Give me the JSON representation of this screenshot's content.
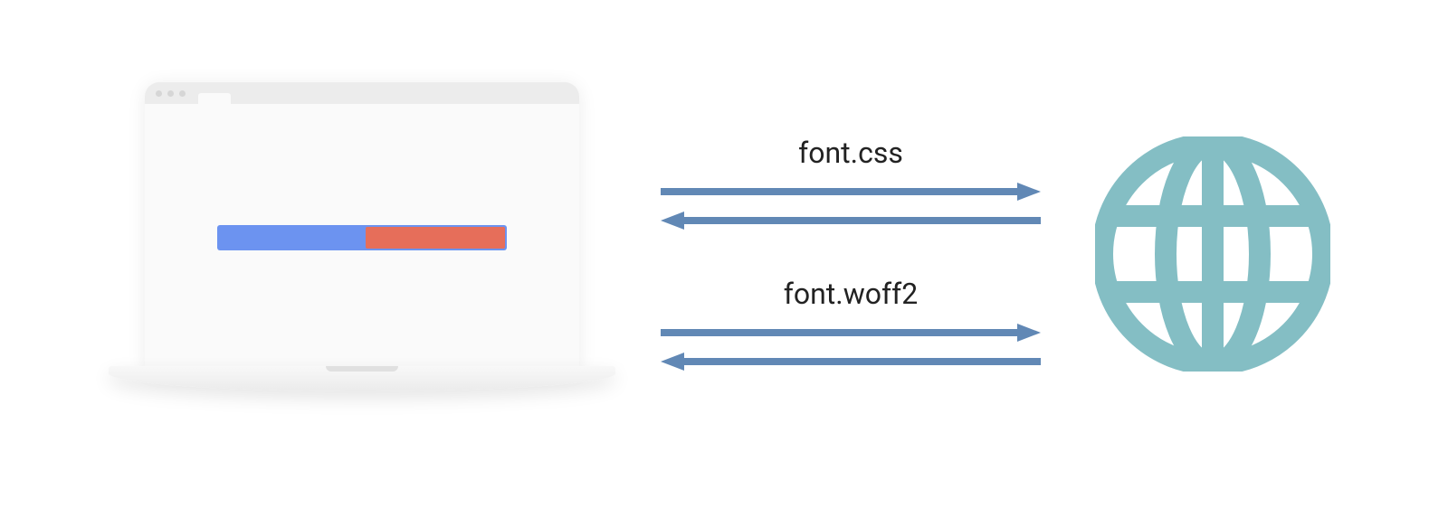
{
  "diagram": {
    "laptop": {
      "progress": {
        "blue_color": "#6c93f0",
        "red_color": "#e66e5a",
        "red_fraction": 0.48
      }
    },
    "arrows": {
      "first_label": "font.css",
      "second_label": "font.woff2",
      "color": "#6188b5"
    },
    "globe": {
      "color": "#84bec4"
    }
  }
}
